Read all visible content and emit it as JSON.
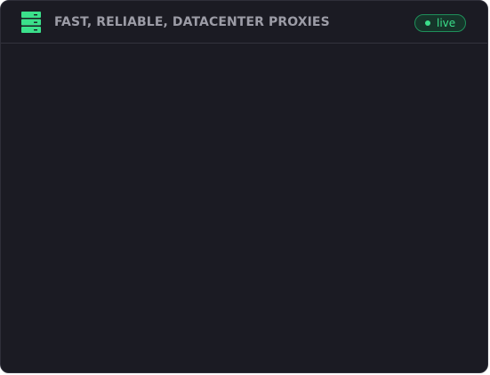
{
  "header": {
    "title": "FAST, RELIABLE, DATACENTER PROXIES",
    "icon": "server-icon",
    "status_badge": {
      "label": "live",
      "color": "#3be08b"
    }
  },
  "colors": {
    "background": "#1b1b23",
    "accent": "#3be08b",
    "title_text": "#9c9ca6"
  }
}
